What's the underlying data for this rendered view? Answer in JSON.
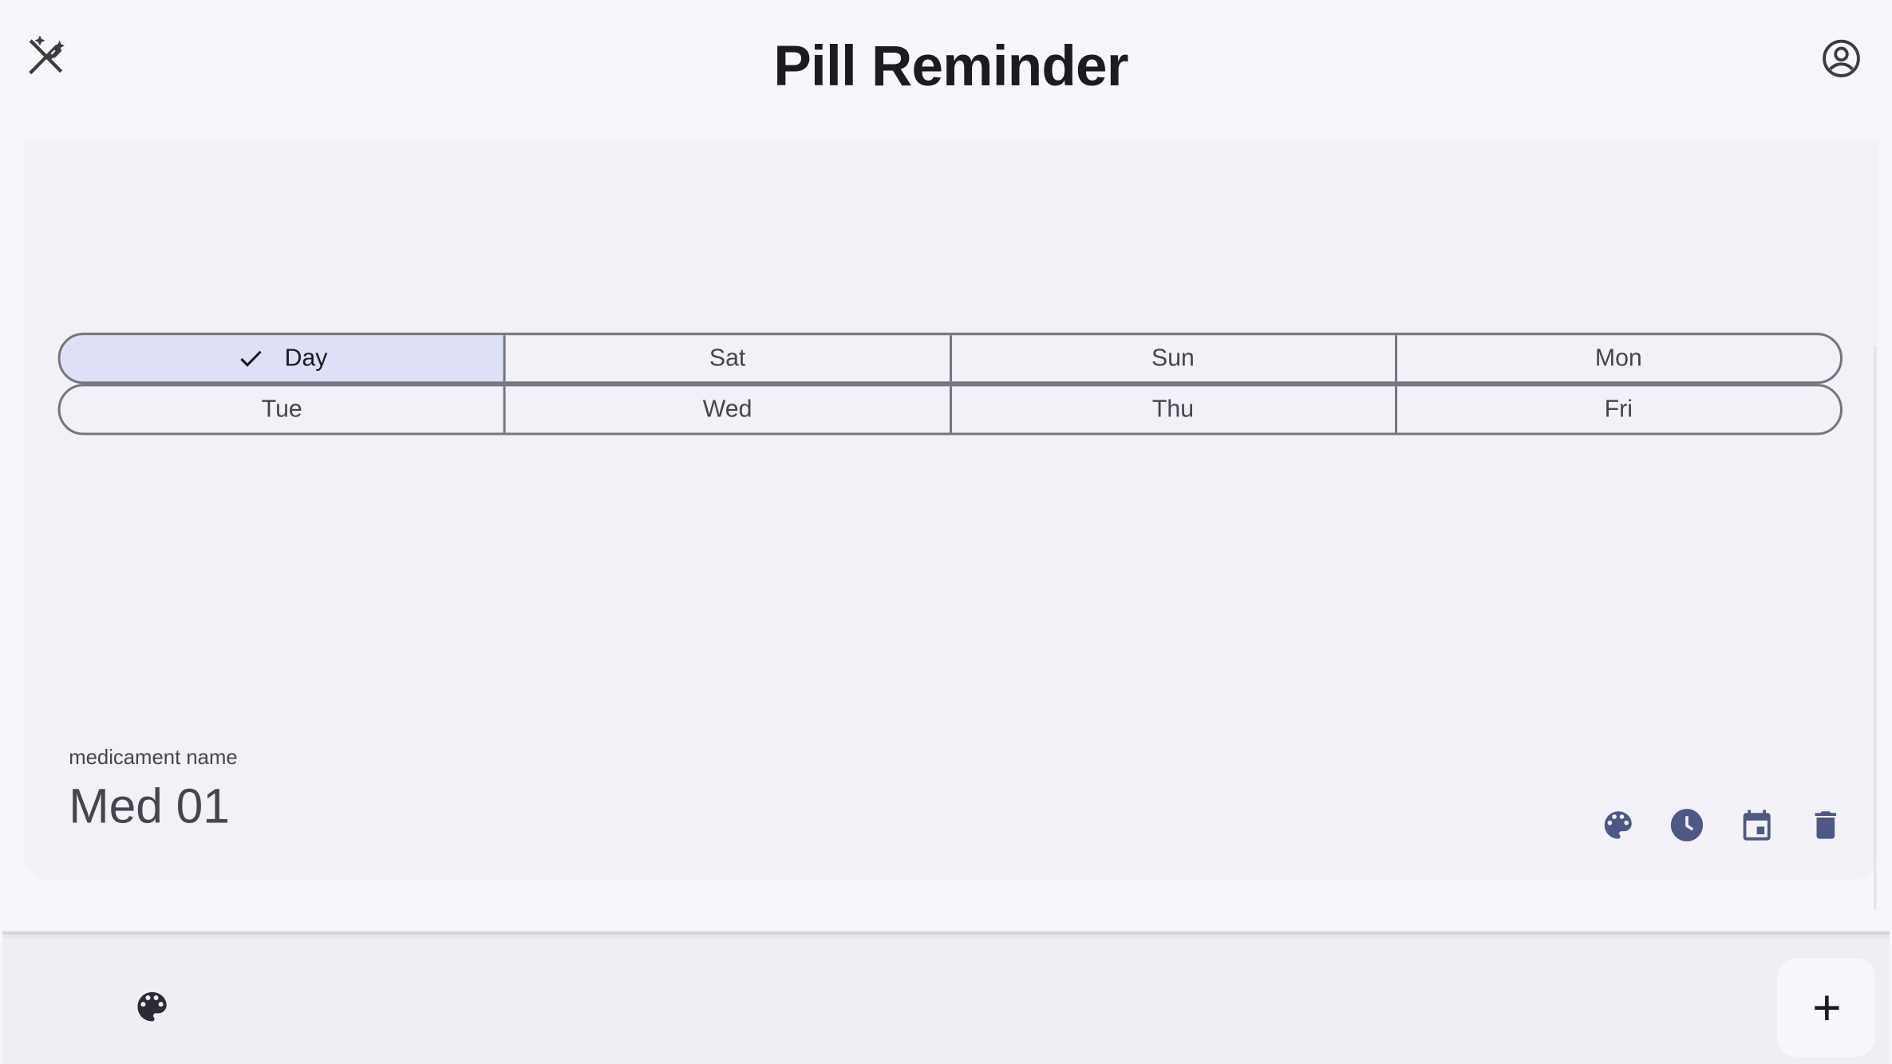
{
  "app_bar": {
    "title": "Pill Reminder",
    "left_icon": "auto-fix-off-icon",
    "right_icon": "account-circle-icon"
  },
  "days": {
    "row1": [
      {
        "label": "Day",
        "selected": true
      },
      {
        "label": "Sat",
        "selected": false
      },
      {
        "label": "Sun",
        "selected": false
      },
      {
        "label": "Mon",
        "selected": false
      }
    ],
    "row2": [
      {
        "label": "Tue",
        "selected": false
      },
      {
        "label": "Wed",
        "selected": false
      },
      {
        "label": "Thu",
        "selected": false
      },
      {
        "label": "Fri",
        "selected": false
      }
    ]
  },
  "medicament": {
    "label": "medicament name",
    "name": "Med 01",
    "actions": [
      "palette-icon",
      "clock-icon",
      "calendar-icon",
      "delete-icon"
    ]
  },
  "bottom_bar": {
    "left_icon": "palette-icon",
    "fab_icon": "add-icon"
  },
  "colors": {
    "background": "#f7f6fb",
    "card": "#f2f1f7",
    "selected_segment": "#dde0f6",
    "icon_accent": "#4e5884",
    "text": "#1b1b20"
  }
}
